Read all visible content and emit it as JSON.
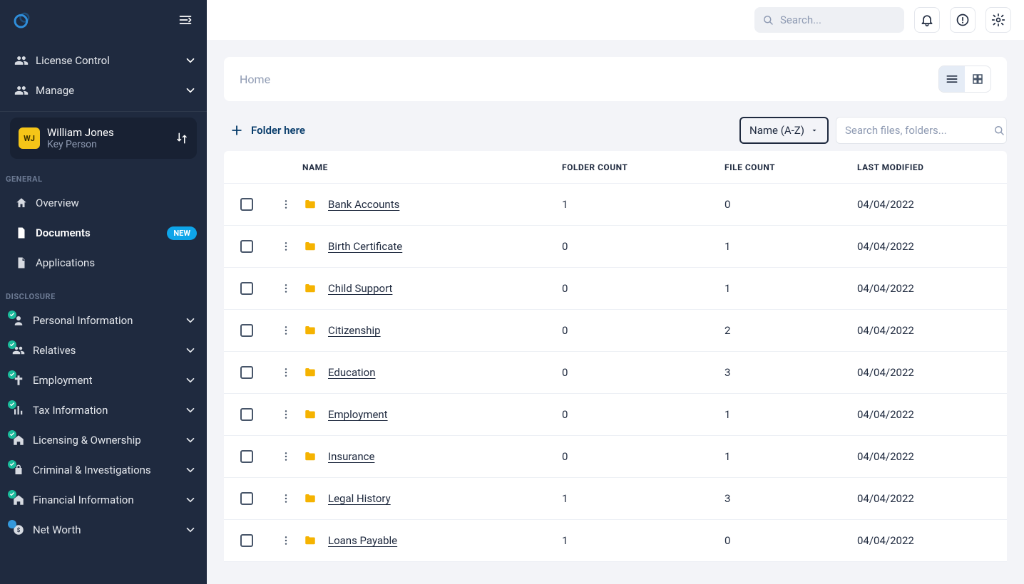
{
  "topbar": {
    "search_placeholder": "Search..."
  },
  "sidebar": {
    "top": [
      {
        "label": "License Control"
      },
      {
        "label": "Manage"
      }
    ],
    "user": {
      "initials": "WJ",
      "name": "William Jones",
      "role": "Key Person"
    },
    "sections": {
      "general": {
        "label": "GENERAL",
        "items": [
          {
            "label": "Overview"
          },
          {
            "label": "Documents",
            "badge": "NEW",
            "active": true
          },
          {
            "label": "Applications"
          }
        ]
      },
      "disclosure": {
        "label": "DISCLOSURE",
        "items": [
          {
            "label": "Personal Information"
          },
          {
            "label": "Relatives"
          },
          {
            "label": "Employment"
          },
          {
            "label": "Tax Information"
          },
          {
            "label": "Licensing & Ownership"
          },
          {
            "label": "Criminal & Investigations"
          },
          {
            "label": "Financial Information"
          },
          {
            "label": "Net Worth"
          }
        ]
      }
    }
  },
  "breadcrumb": "Home",
  "actions": {
    "folder_here": "Folder here",
    "sort": "Name (A-Z)",
    "file_search_placeholder": "Search files, folders..."
  },
  "table": {
    "columns": {
      "name": "NAME",
      "folder_count": "FOLDER COUNT",
      "file_count": "FILE COUNT",
      "last_modified": "LAST MODIFIED"
    },
    "rows": [
      {
        "name": "Bank Accounts",
        "folder_count": "1",
        "file_count": "0",
        "last_modified": "04/04/2022"
      },
      {
        "name": "Birth Certificate",
        "folder_count": "0",
        "file_count": "1",
        "last_modified": "04/04/2022"
      },
      {
        "name": "Child Support",
        "folder_count": "0",
        "file_count": "1",
        "last_modified": "04/04/2022"
      },
      {
        "name": "Citizenship",
        "folder_count": "0",
        "file_count": "2",
        "last_modified": "04/04/2022"
      },
      {
        "name": "Education",
        "folder_count": "0",
        "file_count": "3",
        "last_modified": "04/04/2022"
      },
      {
        "name": "Employment",
        "folder_count": "0",
        "file_count": "1",
        "last_modified": "04/04/2022"
      },
      {
        "name": "Insurance",
        "folder_count": "0",
        "file_count": "1",
        "last_modified": "04/04/2022"
      },
      {
        "name": "Legal History",
        "folder_count": "1",
        "file_count": "3",
        "last_modified": "04/04/2022"
      },
      {
        "name": "Loans Payable",
        "folder_count": "1",
        "file_count": "0",
        "last_modified": "04/04/2022"
      }
    ]
  }
}
